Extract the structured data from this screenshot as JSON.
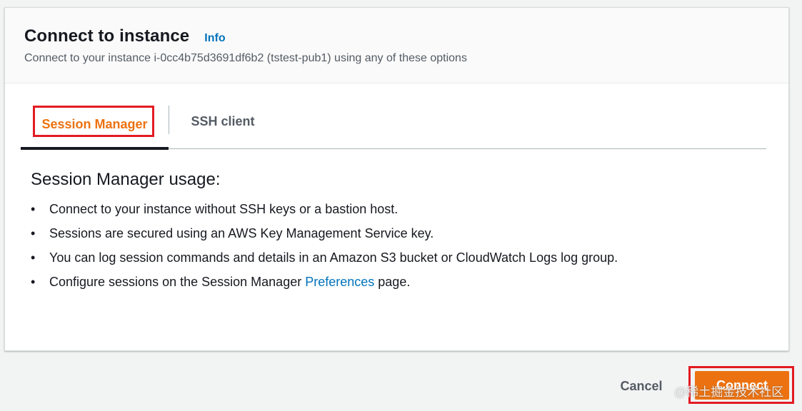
{
  "header": {
    "title": "Connect to instance",
    "info_link": "Info",
    "subtitle": "Connect to your instance i-0cc4b75d3691df6b2 (tstest-pub1) using any of these options"
  },
  "tabs": [
    {
      "label": "Session Manager",
      "selected": true
    },
    {
      "label": "SSH client",
      "selected": false
    }
  ],
  "content": {
    "heading": "Session Manager usage:",
    "bullets": [
      "Connect to your instance without SSH keys or a bastion host.",
      "Sessions are secured using an AWS Key Management Service key.",
      "You can log session commands and details in an Amazon S3 bucket or CloudWatch Logs log group."
    ],
    "last_bullet": {
      "prefix": "Configure sessions on the Session Manager ",
      "link": "Preferences",
      "suffix": " page."
    }
  },
  "footer": {
    "cancel_label": "Cancel",
    "connect_label": "Connect"
  },
  "watermark": "@稀土掘金技术社区",
  "colors": {
    "accent_orange": "#ec7211",
    "link_blue": "#0073bb",
    "highlight_red": "#e31b23"
  }
}
